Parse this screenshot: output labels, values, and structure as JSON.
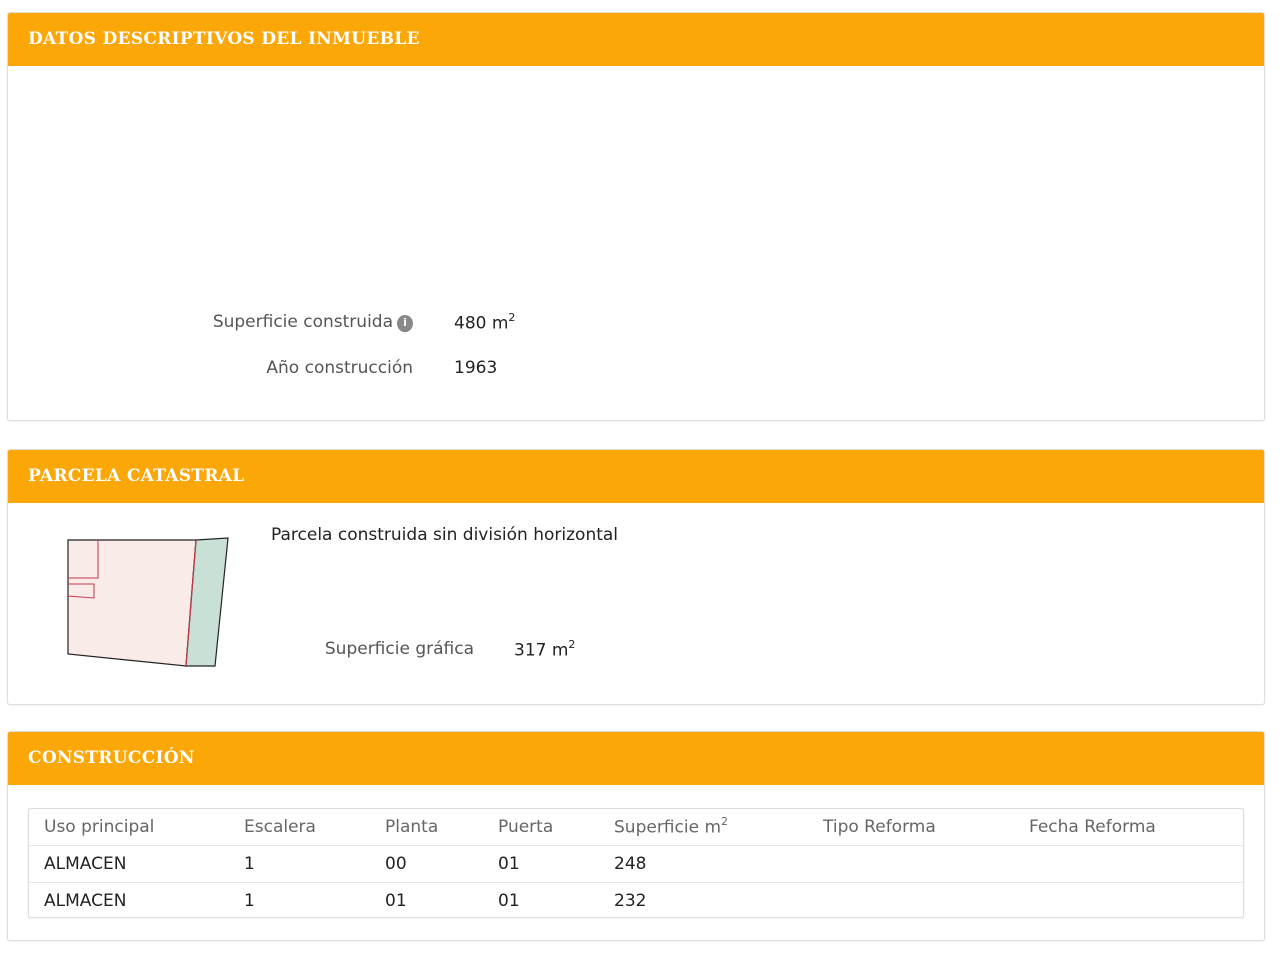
{
  "datos": {
    "header": "DATOS DESCRIPTIVOS DEL INMUEBLE",
    "superficie_construida": {
      "label": "Superficie construida",
      "value": "480 m",
      "unit_exp": "2"
    },
    "anio_construccion": {
      "label": "Año construcción",
      "value": "1963"
    },
    "info_icon": "info-icon"
  },
  "parcela": {
    "header": "PARCELA CATASTRAL",
    "descripcion": "Parcela construida sin división horizontal",
    "superficie_grafica": {
      "label": "Superficie gráfica",
      "value": "317 m",
      "unit_exp": "2"
    }
  },
  "construccion": {
    "header": "CONSTRUCCIÓN",
    "columns": [
      "Uso principal",
      "Escalera",
      "Planta",
      "Puerta",
      "Superficie m",
      "Tipo Reforma",
      "Fecha Reforma"
    ],
    "superficie_exp": "2",
    "rows": [
      [
        "ALMACEN",
        "1",
        "00",
        "01",
        "248",
        "",
        ""
      ],
      [
        "ALMACEN",
        "1",
        "01",
        "01",
        "232",
        "",
        ""
      ]
    ]
  },
  "colors": {
    "header": "#fba707",
    "plot_fill": "#f8ebe8",
    "plot_green": "#c9e0d7",
    "plot_red_line": "#c23a4a"
  }
}
